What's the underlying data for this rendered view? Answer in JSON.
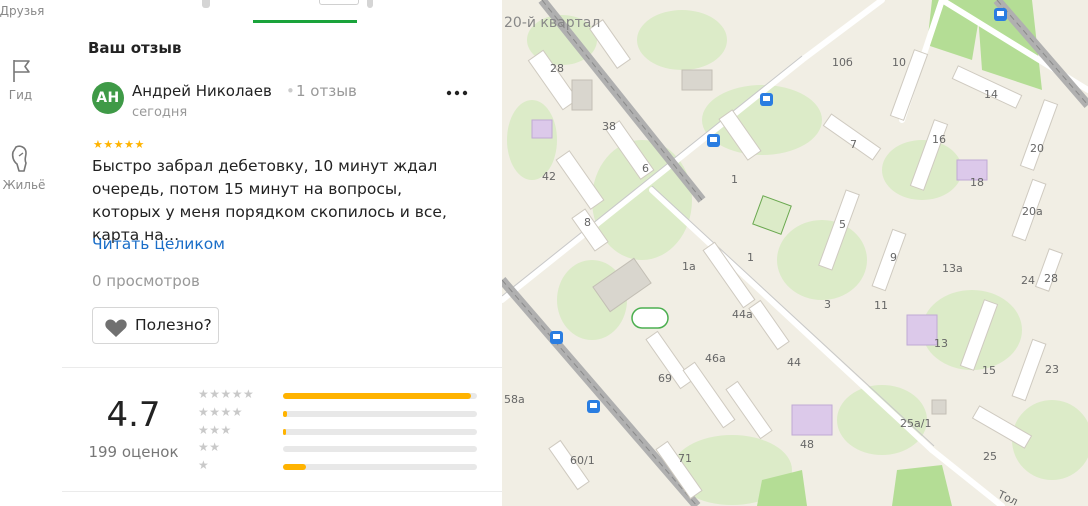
{
  "rail": {
    "items": [
      {
        "label": "Друзья"
      },
      {
        "label": "Гид"
      },
      {
        "label": "Жильё"
      }
    ]
  },
  "review": {
    "section_title": "Ваш отзыв",
    "avatar_initials": "АН",
    "author_name": "Андрей Николаев",
    "author_sep": "•",
    "author_reviews": "1 отзыв",
    "date": "сегодня",
    "rating_stars": "★★★★★",
    "rating": 5,
    "more_icon": "more-icon",
    "text": "Быстро забрал дебетовку, 10 минут ждал очередь, потом 15 минут на вопросы, которых у меня порядком скопилось и все, карта на…",
    "read_more": "Читать целиком",
    "views": "0 просмотров",
    "useful_label": "Полезно?"
  },
  "summary": {
    "rating_value": "4.7",
    "rating_count": "199 оценок",
    "distribution": [
      {
        "stars": "★★★★★",
        "fraction": 0.97
      },
      {
        "stars": "★★★★",
        "fraction": 0.02
      },
      {
        "stars": "★★★",
        "fraction": 0.015
      },
      {
        "stars": "★★",
        "fraction": 0.0
      },
      {
        "stars": "★",
        "fraction": 0.12
      }
    ]
  },
  "map": {
    "district_label": "20-й квартал",
    "street_label": "Тол",
    "house_numbers": [
      "28",
      "38",
      "42",
      "6",
      "8",
      "10б",
      "10",
      "14",
      "16",
      "7",
      "1",
      "5",
      "20",
      "18",
      "20а",
      "9",
      "13а",
      "24",
      "1а",
      "1",
      "3",
      "11",
      "28",
      "44а",
      "13",
      "46а",
      "44",
      "69",
      "15",
      "23",
      "58а",
      "48",
      "25а/1",
      "60/1",
      "71",
      "25"
    ]
  },
  "colors": {
    "accent_green": "#1aa33b",
    "star_yellow": "#ffb300",
    "link_blue": "#1a6ec8",
    "avatar_green": "#3f9a47",
    "transit_blue": "#2a7de1"
  }
}
